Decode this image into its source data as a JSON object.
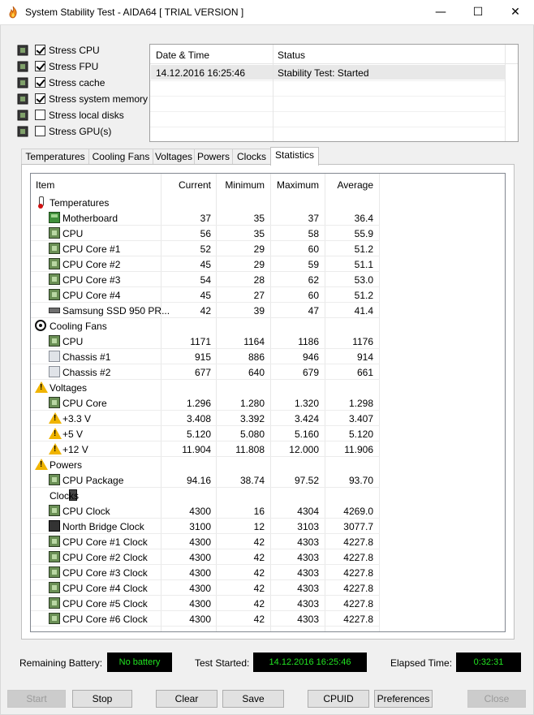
{
  "window": {
    "title": "System Stability Test - AIDA64  [ TRIAL VERSION ]",
    "minimize_glyph": "—",
    "maximize_glyph": "☐",
    "close_glyph": "✕"
  },
  "stress_options": [
    {
      "label": "Stress CPU",
      "checked": true,
      "icon": "cpu-chip-icon"
    },
    {
      "label": "Stress FPU",
      "checked": true,
      "icon": "fpu-chip-icon"
    },
    {
      "label": "Stress cache",
      "checked": true,
      "icon": "cache-icon"
    },
    {
      "label": "Stress system memory",
      "checked": true,
      "icon": "memory-icon"
    },
    {
      "label": "Stress local disks",
      "checked": false,
      "icon": "disk-icon"
    },
    {
      "label": "Stress GPU(s)",
      "checked": false,
      "icon": "monitor-icon"
    }
  ],
  "log": {
    "col_datetime": "Date & Time",
    "col_status": "Status",
    "entries": [
      {
        "datetime": "14.12.2016 16:25:46",
        "status": "Stability Test: Started"
      }
    ]
  },
  "tabs": [
    "Temperatures",
    "Cooling Fans",
    "Voltages",
    "Powers",
    "Clocks",
    "Statistics"
  ],
  "active_tab": "Statistics",
  "stats": {
    "columns": {
      "item": "Item",
      "current": "Current",
      "minimum": "Minimum",
      "maximum": "Maximum",
      "average": "Average"
    },
    "groups": [
      {
        "label": "Temperatures",
        "icon": "thermometer-icon",
        "rows": [
          {
            "name": "Motherboard",
            "icon": "motherboard-icon",
            "cur": "37",
            "min": "35",
            "max": "37",
            "avg": "36.4"
          },
          {
            "name": "CPU",
            "icon": "cpu-icon",
            "cur": "56",
            "min": "35",
            "max": "58",
            "avg": "55.9"
          },
          {
            "name": "CPU Core #1",
            "icon": "cpu-icon",
            "cur": "52",
            "min": "29",
            "max": "60",
            "avg": "51.2"
          },
          {
            "name": "CPU Core #2",
            "icon": "cpu-icon",
            "cur": "45",
            "min": "29",
            "max": "59",
            "avg": "51.1"
          },
          {
            "name": "CPU Core #3",
            "icon": "cpu-icon",
            "cur": "54",
            "min": "28",
            "max": "62",
            "avg": "53.0"
          },
          {
            "name": "CPU Core #4",
            "icon": "cpu-icon",
            "cur": "45",
            "min": "27",
            "max": "60",
            "avg": "51.2"
          },
          {
            "name": "Samsung SSD 950 PR...",
            "icon": "ssd-icon",
            "cur": "42",
            "min": "39",
            "max": "47",
            "avg": "41.4"
          }
        ]
      },
      {
        "label": "Cooling Fans",
        "icon": "fan-icon",
        "rows": [
          {
            "name": "CPU",
            "icon": "cpu-icon",
            "cur": "1171",
            "min": "1164",
            "max": "1186",
            "avg": "1176"
          },
          {
            "name": "Chassis #1",
            "icon": "case-icon",
            "cur": "915",
            "min": "886",
            "max": "946",
            "avg": "914"
          },
          {
            "name": "Chassis #2",
            "icon": "case-icon",
            "cur": "677",
            "min": "640",
            "max": "679",
            "avg": "661"
          }
        ]
      },
      {
        "label": "Voltages",
        "icon": "warning-icon",
        "rows": [
          {
            "name": "CPU Core",
            "icon": "cpu-icon",
            "cur": "1.296",
            "min": "1.280",
            "max": "1.320",
            "avg": "1.298"
          },
          {
            "name": "+3.3 V",
            "icon": "warning-icon",
            "cur": "3.408",
            "min": "3.392",
            "max": "3.424",
            "avg": "3.407"
          },
          {
            "name": "+5 V",
            "icon": "warning-icon",
            "cur": "5.120",
            "min": "5.080",
            "max": "5.160",
            "avg": "5.120"
          },
          {
            "name": "+12 V",
            "icon": "warning-icon",
            "cur": "11.904",
            "min": "11.808",
            "max": "12.000",
            "avg": "11.906"
          }
        ]
      },
      {
        "label": "Powers",
        "icon": "warning-icon",
        "rows": [
          {
            "name": "CPU Package",
            "icon": "cpu-icon",
            "cur": "94.16",
            "min": "38.74",
            "max": "97.52",
            "avg": "93.70"
          }
        ]
      },
      {
        "label": "Clocks",
        "icon": "clock-chip-icon",
        "rows": [
          {
            "name": "CPU Clock",
            "icon": "cpu-icon",
            "cur": "4300",
            "min": "16",
            "max": "4304",
            "avg": "4269.0"
          },
          {
            "name": "North Bridge Clock",
            "icon": "northbridge-icon",
            "cur": "3100",
            "min": "12",
            "max": "3103",
            "avg": "3077.7"
          },
          {
            "name": "CPU Core #1 Clock",
            "icon": "cpu-icon",
            "cur": "4300",
            "min": "42",
            "max": "4303",
            "avg": "4227.8"
          },
          {
            "name": "CPU Core #2 Clock",
            "icon": "cpu-icon",
            "cur": "4300",
            "min": "42",
            "max": "4303",
            "avg": "4227.8"
          },
          {
            "name": "CPU Core #3 Clock",
            "icon": "cpu-icon",
            "cur": "4300",
            "min": "42",
            "max": "4303",
            "avg": "4227.8"
          },
          {
            "name": "CPU Core #4 Clock",
            "icon": "cpu-icon",
            "cur": "4300",
            "min": "42",
            "max": "4303",
            "avg": "4227.8"
          },
          {
            "name": "CPU Core #5 Clock",
            "icon": "cpu-icon",
            "cur": "4300",
            "min": "42",
            "max": "4303",
            "avg": "4227.8"
          },
          {
            "name": "CPU Core #6 Clock",
            "icon": "cpu-icon",
            "cur": "4300",
            "min": "42",
            "max": "4303",
            "avg": "4227.8"
          }
        ]
      }
    ]
  },
  "status_bar": {
    "battery_label": "Remaining Battery:",
    "battery_value": "No battery",
    "started_label": "Test Started:",
    "started_value": "14.12.2016 16:25:46",
    "elapsed_label": "Elapsed Time:",
    "elapsed_value": "0:32:31"
  },
  "buttons": {
    "start": "Start",
    "stop": "Stop",
    "clear": "Clear",
    "save": "Save",
    "cpuid": "CPUID",
    "preferences": "Preferences",
    "close": "Close"
  },
  "colors": {
    "lcd_bg": "#000000",
    "lcd_text": "#21e321",
    "log_selected_row": "#e8e8e8",
    "warning": "#f0b400"
  }
}
